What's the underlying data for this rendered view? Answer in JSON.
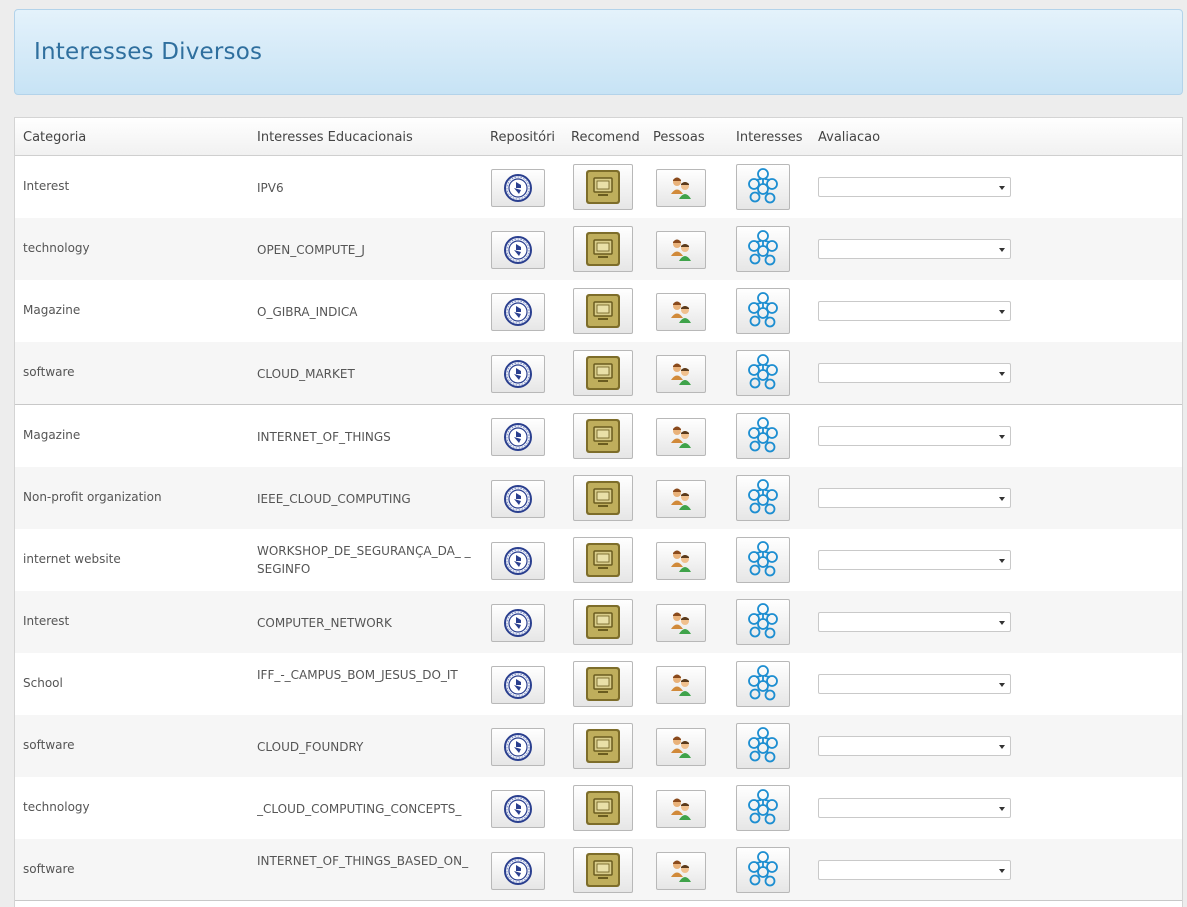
{
  "page": {
    "title": "Interesses Diversos"
  },
  "table": {
    "headers": {
      "categoria": "Categoria",
      "interesses_educacionais": "Interesses Educacionais",
      "repositorio": "Repositóri",
      "recomend": "Recomend",
      "pessoas": "Pessoas",
      "interesses": "Interesses",
      "avaliacao": "Avaliacao"
    },
    "rows": [
      {
        "categoria": "Interest",
        "interesse": "IPV6"
      },
      {
        "categoria": "technology",
        "interesse": "OPEN_COMPUTE_J"
      },
      {
        "categoria": "Magazine",
        "interesse": "O_GIBRA_INDICA"
      },
      {
        "categoria": "software",
        "interesse": "CLOUD_MARKET"
      },
      {
        "categoria": "Magazine",
        "interesse": "INTERNET_OF_THINGS"
      },
      {
        "categoria": "Non-profit organization",
        "interesse": "IEEE_CLOUD_COMPUTING"
      },
      {
        "categoria": "internet website",
        "interesse": "WORKSHOP_DE_SEGURANÇA_DA_ _SEGINFO"
      },
      {
        "categoria": "Interest",
        "interesse": "COMPUTER_NETWORK"
      },
      {
        "categoria": "School",
        "interesse": "IFF_-_CAMPUS_BOM_JESUS_DO_IT"
      },
      {
        "categoria": "software",
        "interesse": "CLOUD_FOUNDRY"
      },
      {
        "categoria": "technology",
        "interesse": "_CLOUD_COMPUTING_CONCEPTS_"
      },
      {
        "categoria": "software",
        "interesse": "INTERNET_OF_THINGS_BASED_ON_"
      }
    ],
    "avaliacao_selected": "",
    "icons": {
      "repositorio": "repository-seal-icon",
      "recomend": "recommendation-monitor-icon",
      "pessoas": "people-icon",
      "interesses": "interests-network-icon"
    }
  },
  "colors": {
    "header_bg": "#c7e3f5",
    "header_text": "#2f6f9e",
    "row_alt": "#f6f6f6"
  }
}
